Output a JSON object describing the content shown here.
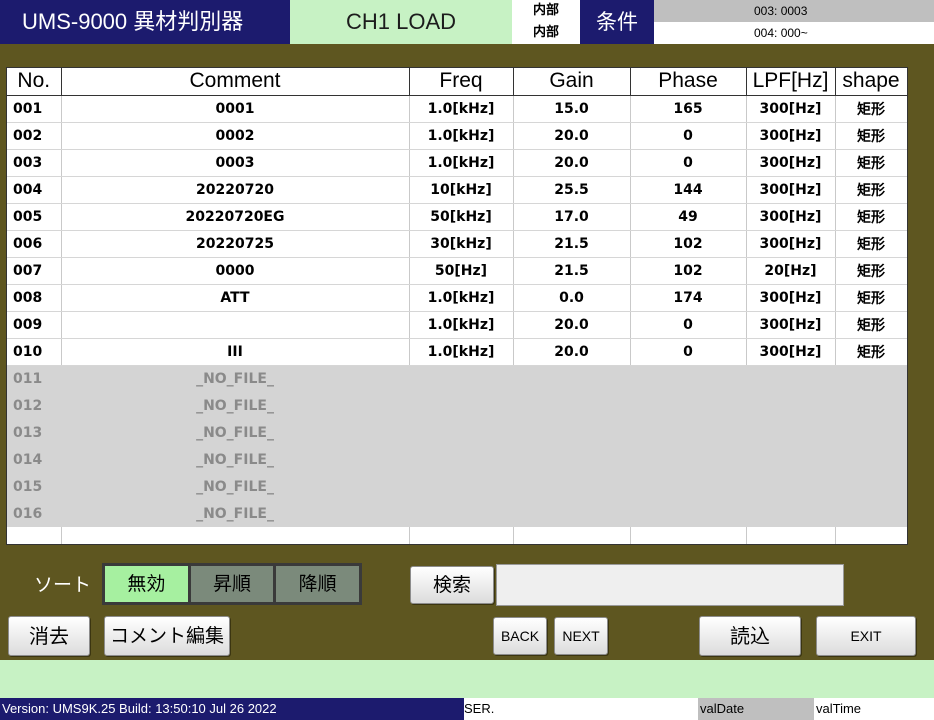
{
  "header": {
    "title": "UMS-9000 異材判別器",
    "mode": "CH1 LOAD",
    "source_top": "内部",
    "source_bottom": "内部",
    "condition": "条件",
    "info_top": "003: 0003",
    "info_bottom": "004: 000~"
  },
  "table": {
    "columns": [
      "No.",
      "Comment",
      "Freq",
      "Gain",
      "Phase",
      "LPF[Hz]",
      "shape"
    ],
    "rows": [
      {
        "no": "001",
        "comment": "0001",
        "freq": "1.0[kHz]",
        "gain": "15.0",
        "phase": "165",
        "lpf": "300[Hz]",
        "shape": "矩形"
      },
      {
        "no": "002",
        "comment": "0002",
        "freq": "1.0[kHz]",
        "gain": "20.0",
        "phase": "0",
        "lpf": "300[Hz]",
        "shape": "矩形"
      },
      {
        "no": "003",
        "comment": "0003",
        "freq": "1.0[kHz]",
        "gain": "20.0",
        "phase": "0",
        "lpf": "300[Hz]",
        "shape": "矩形"
      },
      {
        "no": "004",
        "comment": "20220720",
        "freq": "10[kHz]",
        "gain": "25.5",
        "phase": "144",
        "lpf": "300[Hz]",
        "shape": "矩形"
      },
      {
        "no": "005",
        "comment": "20220720EG",
        "freq": "50[kHz]",
        "gain": "17.0",
        "phase": "49",
        "lpf": "300[Hz]",
        "shape": "矩形"
      },
      {
        "no": "006",
        "comment": "20220725",
        "freq": "30[kHz]",
        "gain": "21.5",
        "phase": "102",
        "lpf": "300[Hz]",
        "shape": "矩形"
      },
      {
        "no": "007",
        "comment": "0000",
        "freq": "50[Hz]",
        "gain": "21.5",
        "phase": "102",
        "lpf": "20[Hz]",
        "shape": "矩形"
      },
      {
        "no": "008",
        "comment": "ATT",
        "freq": "1.0[kHz]",
        "gain": "0.0",
        "phase": "174",
        "lpf": "300[Hz]",
        "shape": "矩形"
      },
      {
        "no": "009",
        "comment": "",
        "freq": "1.0[kHz]",
        "gain": "20.0",
        "phase": "0",
        "lpf": "300[Hz]",
        "shape": "矩形"
      },
      {
        "no": "010",
        "comment": "III",
        "freq": "1.0[kHz]",
        "gain": "20.0",
        "phase": "0",
        "lpf": "300[Hz]",
        "shape": "矩形"
      }
    ],
    "empty_rows": [
      {
        "no": "011",
        "comment": "_NO_FILE_"
      },
      {
        "no": "012",
        "comment": "_NO_FILE_"
      },
      {
        "no": "013",
        "comment": "_NO_FILE_"
      },
      {
        "no": "014",
        "comment": "_NO_FILE_"
      },
      {
        "no": "015",
        "comment": "_NO_FILE_"
      },
      {
        "no": "016",
        "comment": "_NO_FILE_"
      }
    ]
  },
  "sort": {
    "label": "ソート",
    "options": [
      "無効",
      "昇順",
      "降順"
    ],
    "active": "無効"
  },
  "search": {
    "button_label": "検索",
    "value": ""
  },
  "buttons": {
    "erase": "消去",
    "comment_edit": "コメント編集",
    "back": "BACK",
    "next": "NEXT",
    "load": "読込",
    "exit": "EXIT"
  },
  "status": {
    "version": "Version: UMS9K.25 Build: 13:50:10 Jul 26 2022",
    "ser": "SER.",
    "date": "valDate",
    "time": "valTime"
  },
  "colors": {
    "navy": "#1c1b6e",
    "light_green": "#c7f2c4",
    "olive_background": "#5e5620",
    "empty_row_gray": "#d4d4d4"
  }
}
